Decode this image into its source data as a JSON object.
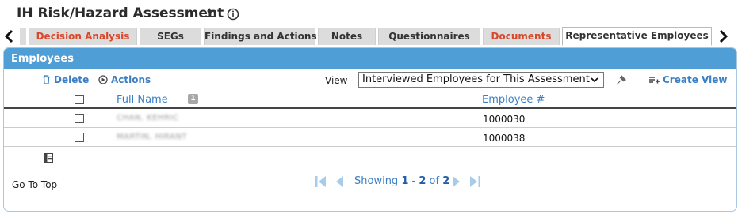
{
  "page": {
    "title": "IH Risk/Hazard Assessment",
    "icons": {
      "undo": "undo-arrow-icon",
      "info": "info-circle-icon"
    }
  },
  "tabs": {
    "items": [
      {
        "label": "Decision Analysis",
        "style": "red"
      },
      {
        "label": "SEGs",
        "style": "normal"
      },
      {
        "label": "Findings and Actions",
        "style": "normal"
      },
      {
        "label": "Notes",
        "style": "normal"
      },
      {
        "label": "Questionnaires",
        "style": "normal"
      },
      {
        "label": "Documents",
        "style": "red"
      },
      {
        "label": "Representative Employees",
        "style": "active"
      }
    ],
    "scroll_left_icon": "chevron-left-icon",
    "scroll_right_icon": "chevron-right-icon"
  },
  "panel": {
    "title": "Employees",
    "toolbar": {
      "delete_label": "Delete",
      "actions_label": "Actions",
      "view_label": "View",
      "view_selected": "Interviewed Employees for This Assessment",
      "create_view_label": "Create View"
    },
    "columns": {
      "full_name": "Full Name",
      "full_name_sort_order": "1",
      "employee_number": "Employee #"
    },
    "rows": [
      {
        "full_name": "CHAN, KEHRIC",
        "employee_number": "1000030"
      },
      {
        "full_name": "MARTIN, HIRANT",
        "employee_number": "1000038"
      }
    ],
    "footer": {
      "go_to_top": "Go To Top",
      "showing_prefix": "Showing",
      "range_start": "1",
      "range_sep": "-",
      "range_end": "2",
      "of": "of",
      "total": "2"
    }
  },
  "colors": {
    "panel_header": "#4f9fd6",
    "link_blue": "#3a7fc4",
    "tab_red": "#d9482b",
    "tab_bg": "#dcdcdc"
  }
}
